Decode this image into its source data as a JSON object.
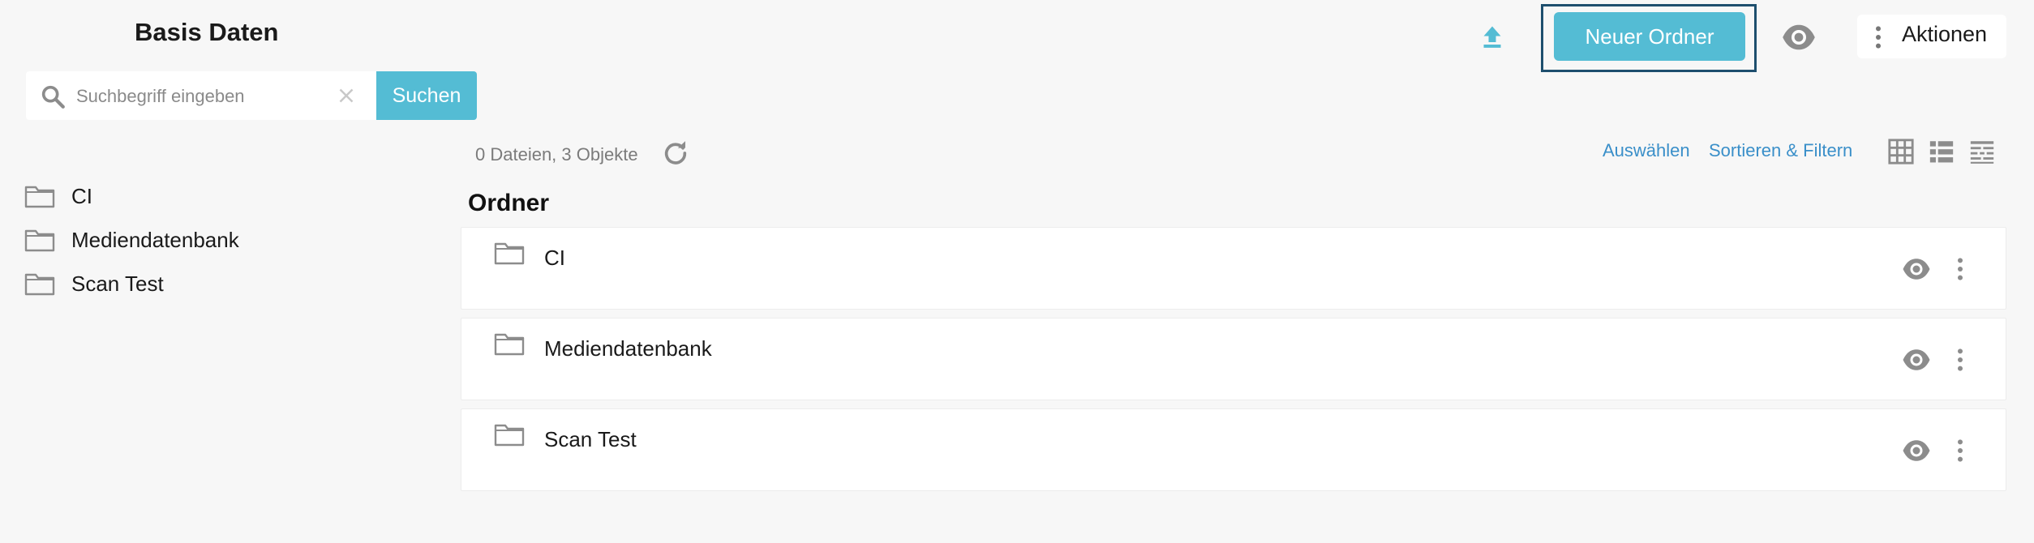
{
  "header": {
    "title": "Basis Daten",
    "new_folder_label": "Neuer Ordner",
    "actions_label": "Aktionen"
  },
  "search": {
    "placeholder": "Suchbegriff eingeben",
    "value": "",
    "button_label": "Suchen"
  },
  "sidebar": {
    "items": [
      {
        "label": "CI",
        "icon": "folder-icon"
      },
      {
        "label": "Mediendatenbank",
        "icon": "folder-icon"
      },
      {
        "label": "Scan Test",
        "icon": "folder-icon"
      }
    ]
  },
  "toolbar": {
    "count_text": "0 Dateien, 3 Objekte",
    "select_label": "Auswählen",
    "sort_filter_label": "Sortieren & Filtern",
    "views": [
      "grid-view-icon",
      "list-view-icon",
      "table-view-icon"
    ]
  },
  "main": {
    "section_title": "Ordner",
    "folders": [
      {
        "label": "CI"
      },
      {
        "label": "Mediendatenbank"
      },
      {
        "label": "Scan Test"
      }
    ]
  },
  "colors": {
    "accent": "#54bcd4",
    "link": "#3a8fc9",
    "icon_gray": "#8c8c8c",
    "focus_border": "#1e4f6e"
  }
}
